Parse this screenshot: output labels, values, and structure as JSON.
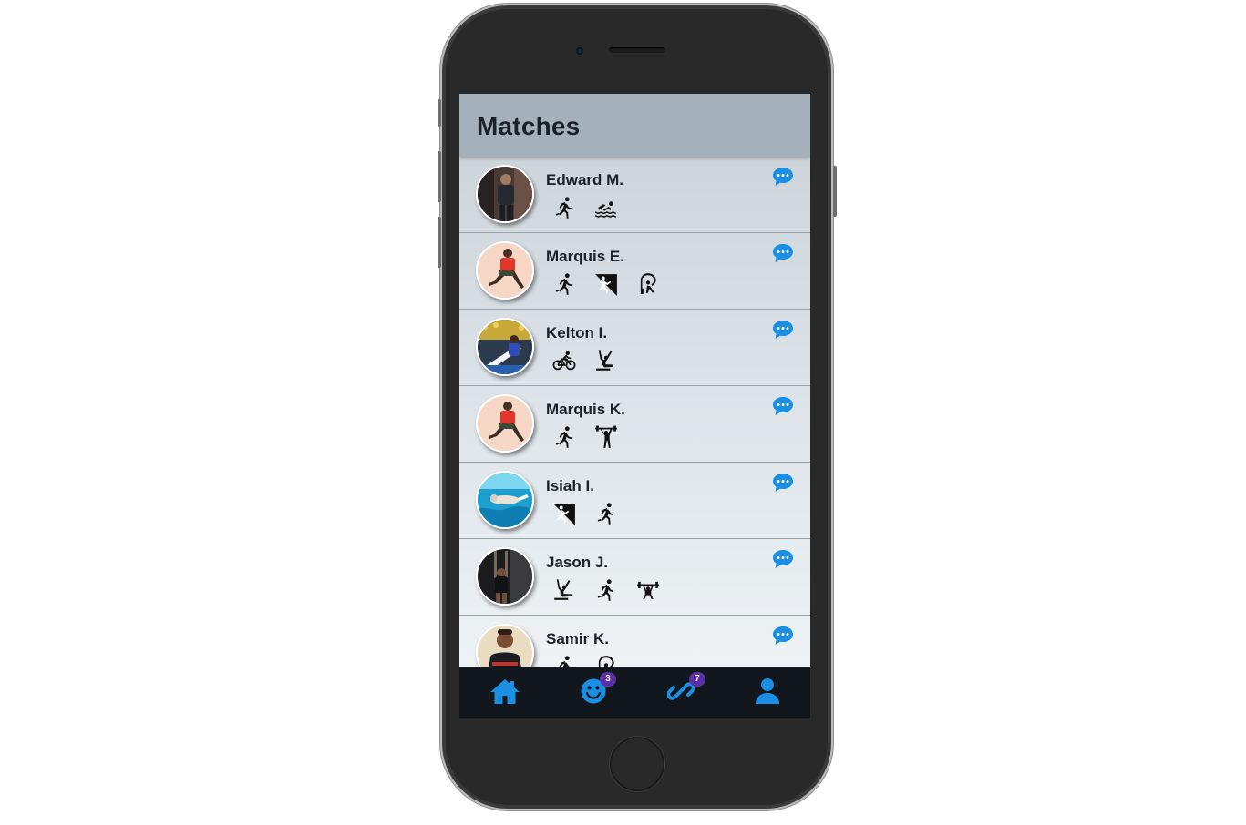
{
  "header": {
    "title": "Matches"
  },
  "matches": [
    {
      "name": "Edward M.",
      "sports": [
        "running-icon",
        "swimming-icon"
      ]
    },
    {
      "name": "Marquis E.",
      "sports": [
        "running-icon",
        "climbing-icon",
        "yoga-icon"
      ]
    },
    {
      "name": "Kelton I.",
      "sports": [
        "cycling-icon",
        "gymnastics-icon"
      ]
    },
    {
      "name": "Marquis K.",
      "sports": [
        "running-icon",
        "weightlifting-icon"
      ]
    },
    {
      "name": "Isiah I.",
      "sports": [
        "climbing-icon",
        "running-icon"
      ]
    },
    {
      "name": "Jason J.",
      "sports": [
        "gymnastics-icon",
        "running-icon",
        "weightlifting-icon"
      ]
    },
    {
      "name": "Samir K.",
      "sports": [
        "running-icon",
        "yoga-icon"
      ]
    }
  ],
  "tabbar": {
    "items": [
      {
        "icon": "home-icon"
      },
      {
        "icon": "smiley-icon",
        "badge": "3"
      },
      {
        "icon": "link-icon",
        "badge": "7"
      },
      {
        "icon": "profile-icon"
      }
    ]
  },
  "colors": {
    "accent": "#1a8fe3",
    "header_bg": "#a4b1ba",
    "tabbar_bg": "#11171c",
    "badge_bg": "#5b2fa7"
  }
}
